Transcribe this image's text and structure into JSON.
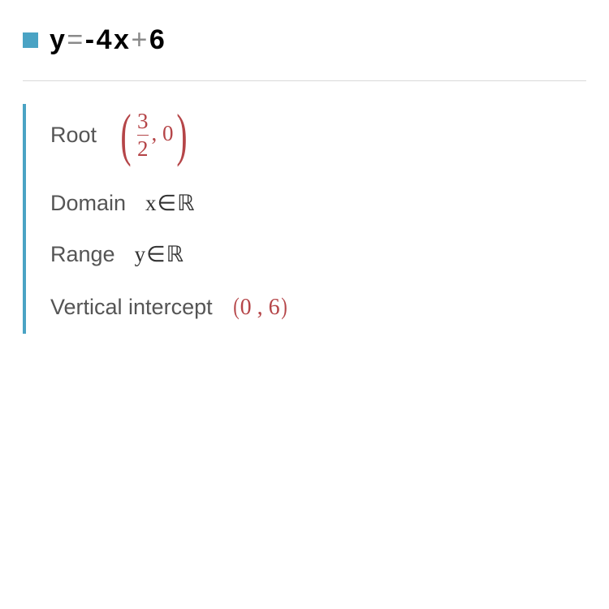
{
  "equation": {
    "y": "y",
    "eq": "=",
    "neg": "-",
    "coef": "4",
    "x": "x",
    "plus": "+",
    "const": "6"
  },
  "root": {
    "label": "Root",
    "numerator": "3",
    "denominator": "2",
    "after": ", 0"
  },
  "domain": {
    "label": "Domain",
    "value": "x∈ℝ"
  },
  "range": {
    "label": "Range",
    "value": "y∈ℝ"
  },
  "intercept": {
    "label": "Vertical intercept",
    "lp": "(",
    "value": "0 , 6",
    "rp": ")"
  }
}
